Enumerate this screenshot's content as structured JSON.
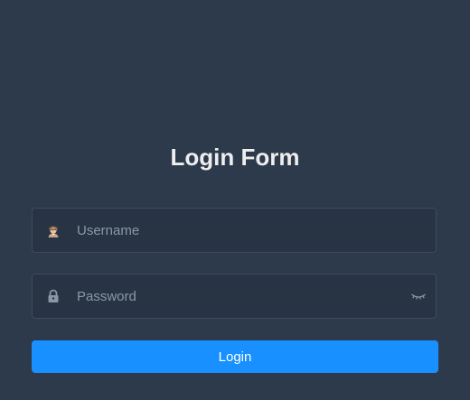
{
  "form": {
    "title": "Login Form",
    "username": {
      "placeholder": "Username",
      "value": "",
      "icon": "user-avatar-icon"
    },
    "password": {
      "placeholder": "Password",
      "value": "",
      "icon": "lock-icon",
      "toggle_icon": "eye-closed-icon"
    },
    "login_label": "Login"
  },
  "colors": {
    "background": "#2d3a4b",
    "field_background": "#283443",
    "field_border": "#3e4b5c",
    "title": "#eeeeee",
    "placeholder": "#889aa4",
    "button": "#1890ff",
    "button_text": "#ffffff"
  }
}
